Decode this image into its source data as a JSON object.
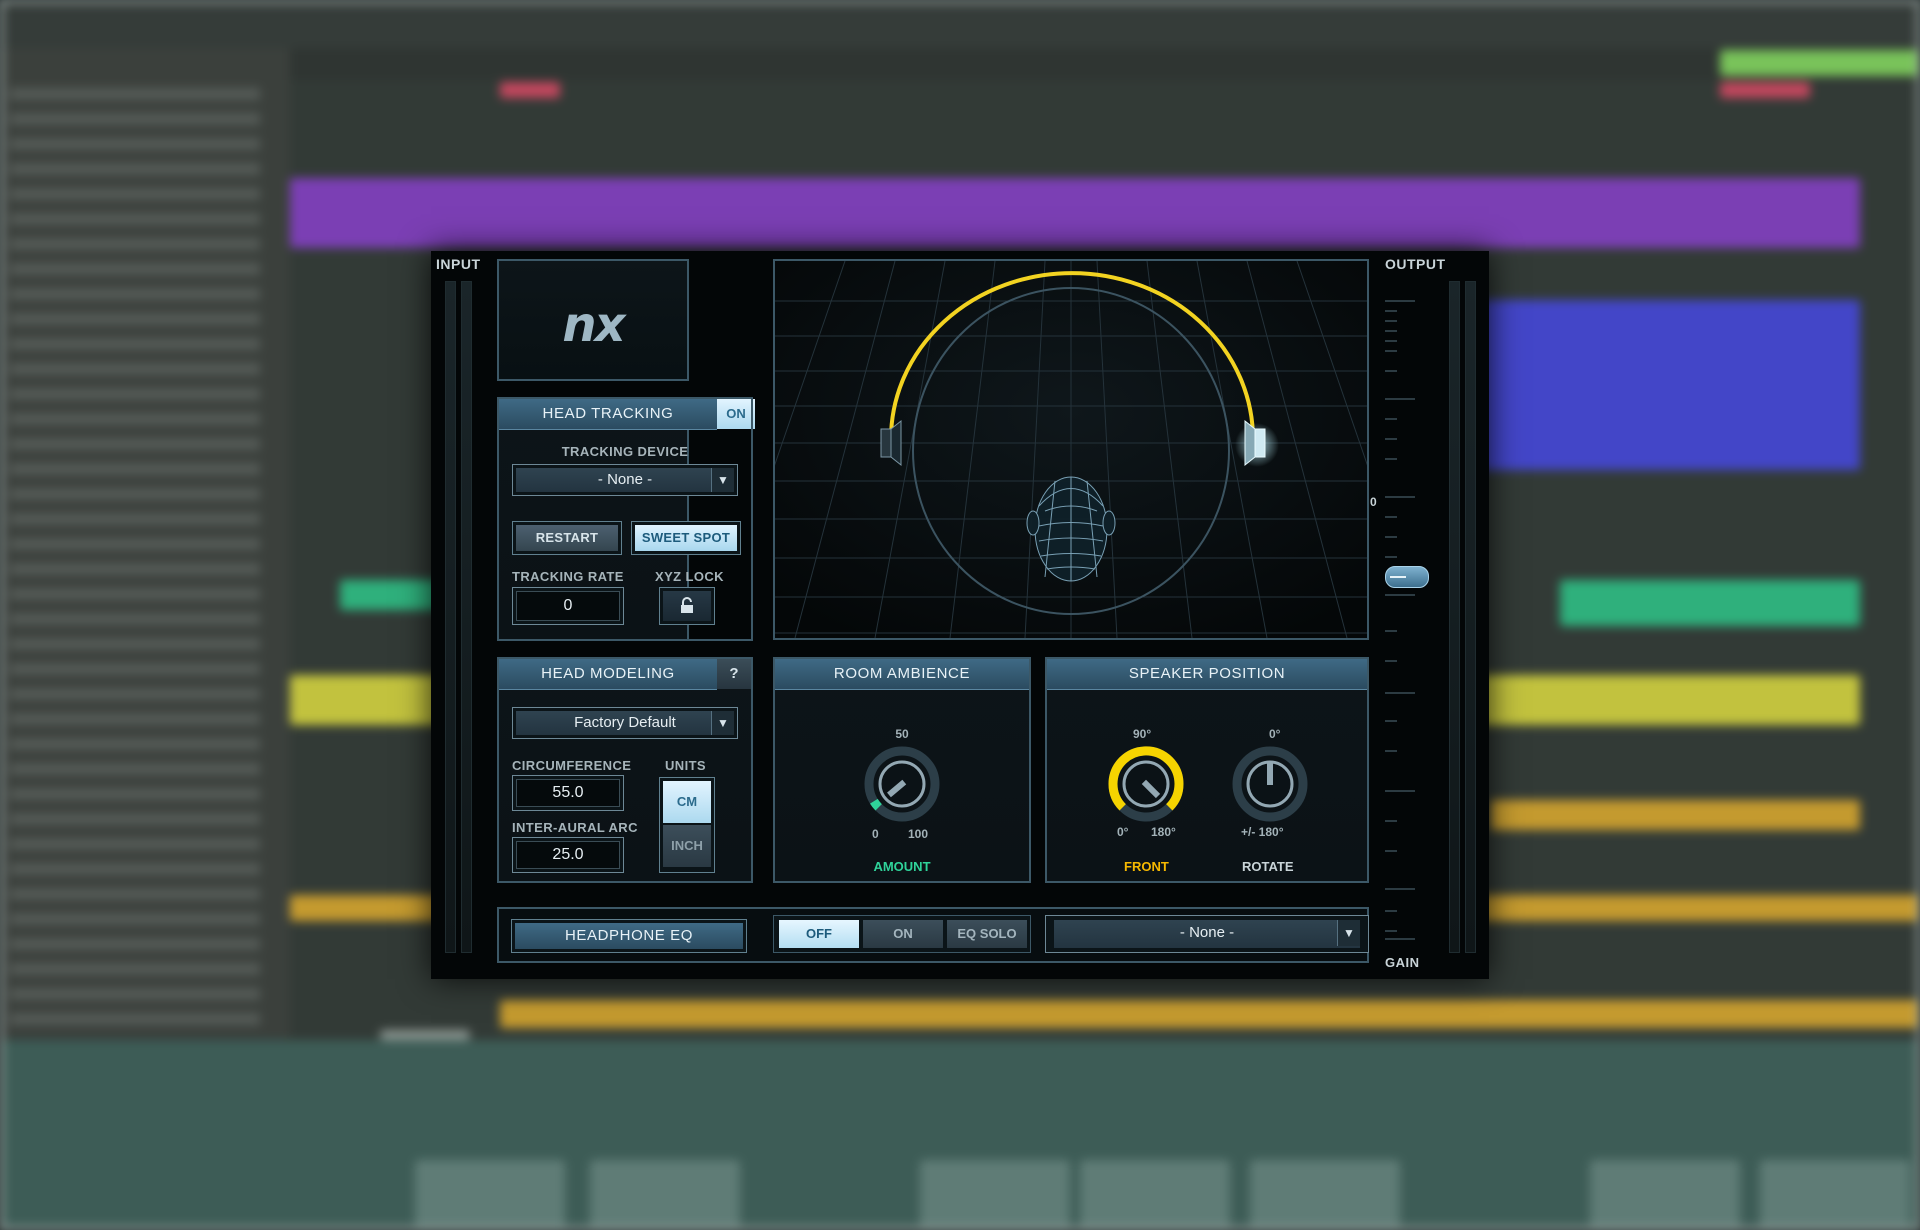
{
  "plugin": {
    "input_label": "INPUT",
    "output_label": "OUTPUT",
    "gain_label": "GAIN",
    "output_scale_zero": "0",
    "logo_text": "nx",
    "head_tracking": {
      "title": "HEAD TRACKING",
      "on_toggle": "ON",
      "tracking_device_label": "TRACKING DEVICE",
      "tracking_device_value": "- None -",
      "restart_label": "RESTART",
      "sweet_spot_label": "SWEET SPOT",
      "tracking_rate_label": "TRACKING RATE",
      "tracking_rate_value": "0",
      "xyz_lock_label": "XYZ LOCK"
    },
    "head_modeling": {
      "title": "HEAD MODELING",
      "help_label": "?",
      "preset_value": "Factory Default",
      "circumference_label": "CIRCUMFERENCE",
      "circumference_value": "55.0",
      "inter_aural_label": "INTER-AURAL  ARC",
      "inter_aural_value": "25.0",
      "units_label": "UNITS",
      "unit_cm": "CM",
      "unit_inch": "INCH"
    },
    "room_ambience": {
      "title": "ROOM AMBIENCE",
      "scale_top": "50",
      "scale_min": "0",
      "scale_max": "100",
      "knob_label": "AMOUNT",
      "amount_value": 0.05
    },
    "speaker_position": {
      "title": "SPEAKER POSITION",
      "front_scale_top": "90°",
      "front_scale_min": "0°",
      "front_scale_max": "180°",
      "front_label": "FRONT",
      "rotate_scale_top": "0°",
      "rotate_scale_range": "+/- 180°",
      "rotate_label": "ROTATE"
    },
    "headphone_eq": {
      "title": "HEADPHONE EQ",
      "off_label": "OFF",
      "on_label": "ON",
      "eq_solo_label": "EQ SOLO",
      "model_value": "- None -"
    },
    "colors": {
      "accent_blue": "#3f6a85",
      "highlight_yellow": "#f3d321",
      "amount_green": "#2fd39a",
      "front_orange": "#f6b800"
    }
  }
}
